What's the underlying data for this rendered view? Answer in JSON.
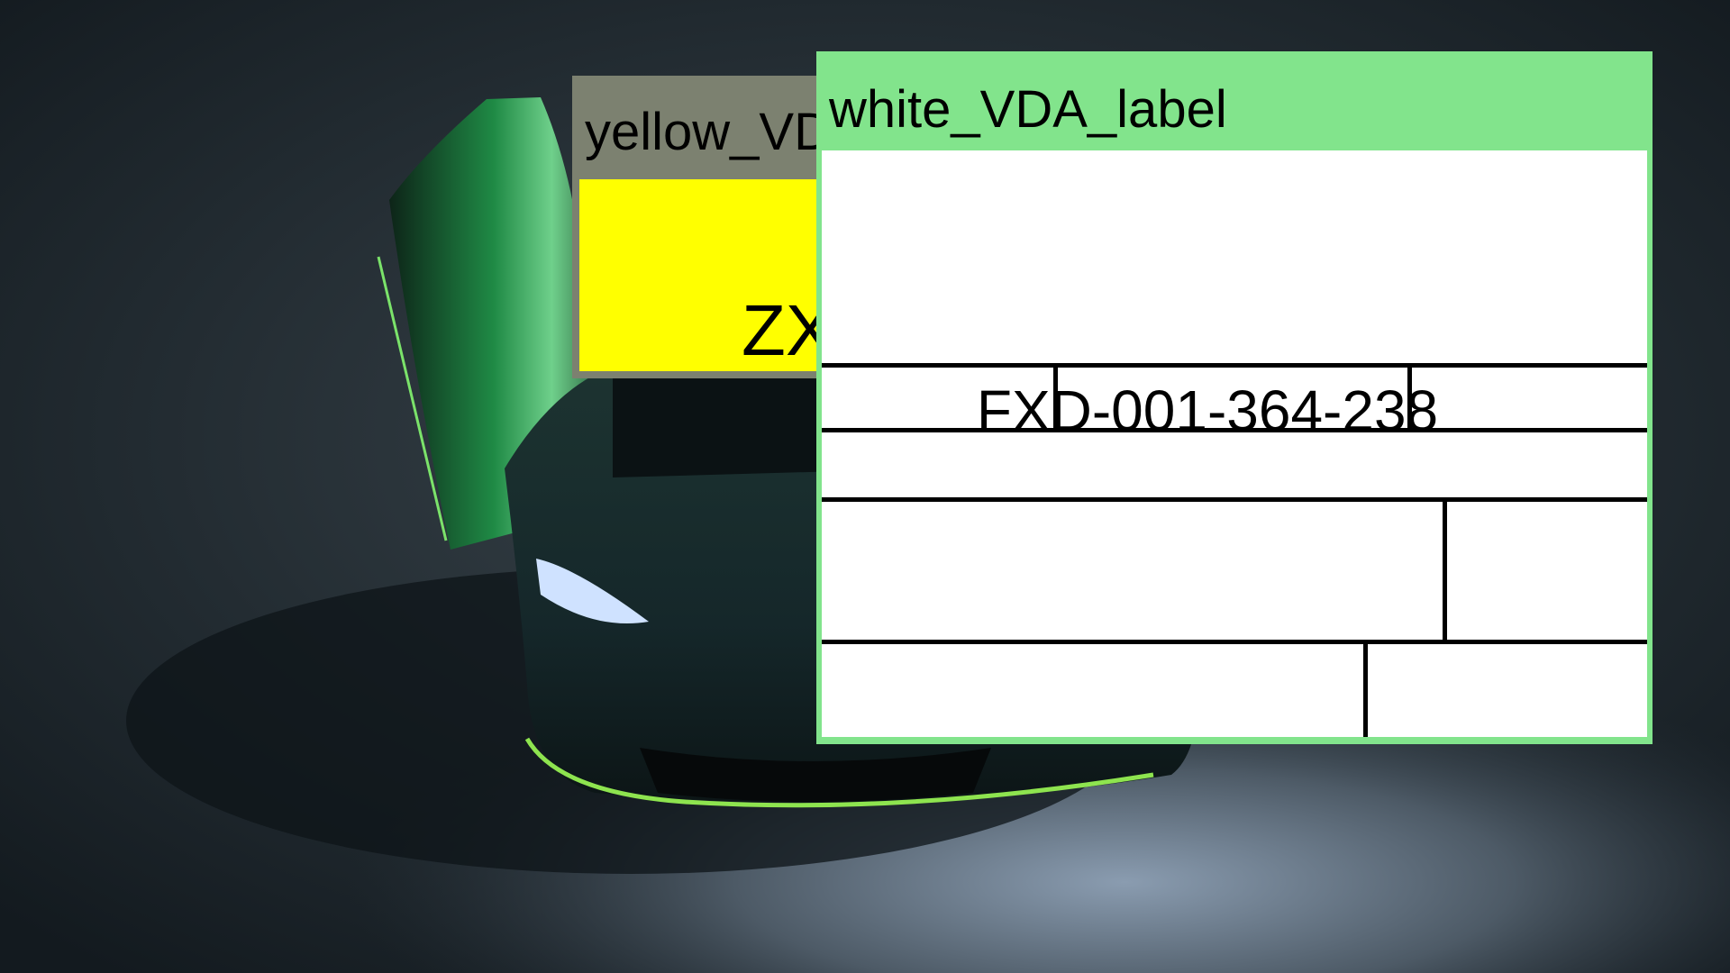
{
  "yellow_panel": {
    "title": "yellow_VDA_label",
    "field_text": "ZX",
    "colors": {
      "frame": "#7c8170",
      "fill": "#ffff00"
    }
  },
  "white_panel": {
    "title": "white_VDA_label",
    "label_id": "FXD-001-364-238",
    "colors": {
      "frame": "#82e48c",
      "fill": "#ffffff"
    }
  }
}
